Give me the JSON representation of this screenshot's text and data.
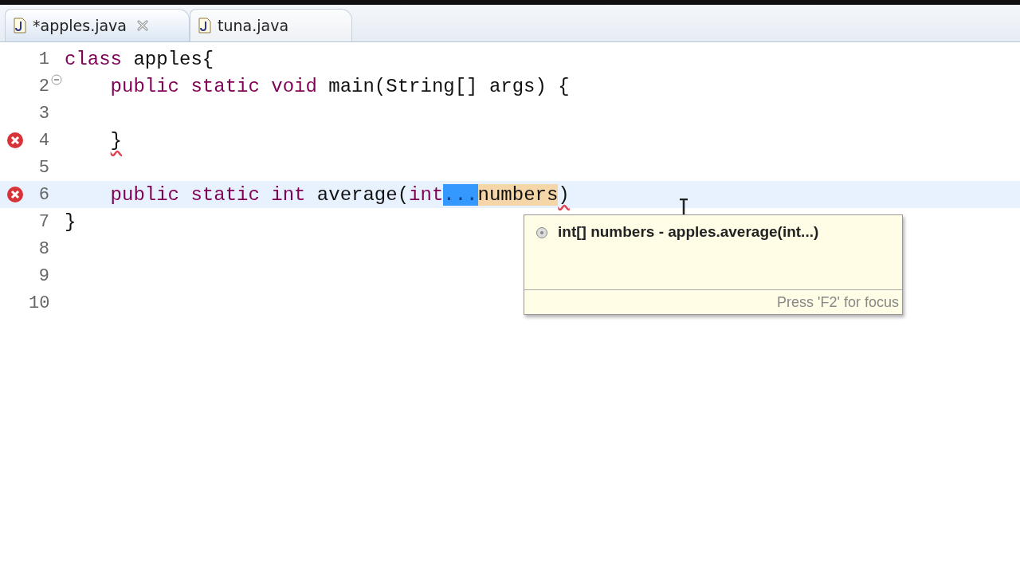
{
  "tabs": [
    {
      "label": "*apples.java",
      "selected": true
    },
    {
      "label": "tuna.java",
      "selected": false
    }
  ],
  "editor": {
    "lines": [
      {
        "number": "1",
        "error": false,
        "current": false,
        "foldable": false,
        "tokens": [
          {
            "kind": "keyword",
            "text": "class"
          },
          {
            "kind": "plain",
            "text": " apples{"
          }
        ]
      },
      {
        "number": "2",
        "error": false,
        "current": false,
        "foldable": true,
        "tokens": [
          {
            "kind": "keyword",
            "text": "    public static void"
          },
          {
            "kind": "plain",
            "text": " main(String[] args) {"
          }
        ]
      },
      {
        "number": "3",
        "error": false,
        "current": false,
        "foldable": false
      },
      {
        "number": "4",
        "error": true,
        "current": false,
        "foldable": false,
        "tokens": [
          {
            "kind": "indent"
          },
          {
            "kind": "error",
            "text": "}"
          }
        ]
      },
      {
        "number": "5",
        "error": false,
        "current": false,
        "foldable": false
      },
      {
        "number": "6",
        "error": true,
        "current": true,
        "foldable": false,
        "tokens": [
          {
            "kind": "keyword",
            "text": "    public static int"
          },
          {
            "kind": "plain",
            "text": " average("
          },
          {
            "kind": "keyword",
            "text": "int"
          },
          {
            "kind": "selected",
            "text": "..."
          },
          {
            "kind": "occurrence",
            "text": "numbers"
          },
          {
            "kind": "error",
            "text": ")"
          }
        ]
      },
      {
        "number": "7",
        "error": false,
        "current": false,
        "foldable": false,
        "tokens": [
          {
            "kind": "plain",
            "text": "}"
          }
        ]
      },
      {
        "number": "8",
        "error": false,
        "current": false,
        "foldable": false
      },
      {
        "number": "9",
        "error": false,
        "current": false,
        "foldable": false
      },
      {
        "number": "10",
        "error": false,
        "current": false,
        "foldable": false
      }
    ]
  },
  "popup": {
    "proposal": "int[] numbers - apples.average(int...)",
    "hint": "Press 'F2' for focus"
  }
}
